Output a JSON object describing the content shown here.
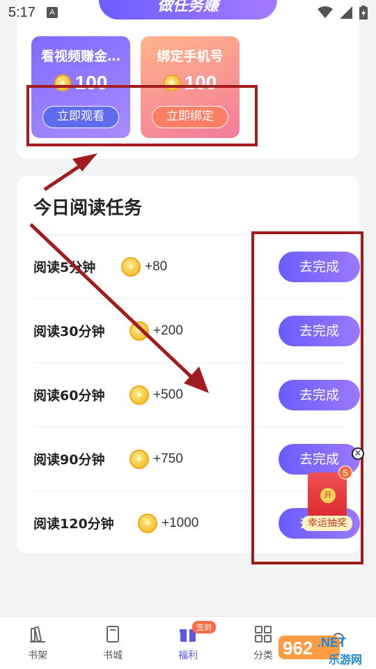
{
  "status": {
    "time": "5:17",
    "app_icon": "A"
  },
  "banner": {
    "text": "做任务赚"
  },
  "top_tasks": [
    {
      "title": "看视频赚金…",
      "reward": "100",
      "button": "立即观看"
    },
    {
      "title": "绑定手机号",
      "reward": "100",
      "button": "立即绑定"
    }
  ],
  "daily": {
    "title": "今日阅读任务",
    "rows": [
      {
        "label": "阅读5分钟",
        "reward": "+80",
        "button": "去完成"
      },
      {
        "label": "阅读30分钟",
        "reward": "+200",
        "button": "去完成"
      },
      {
        "label": "阅读60分钟",
        "reward": "+500",
        "button": "去完成"
      },
      {
        "label": "阅读90分钟",
        "reward": "+750",
        "button": "去完成"
      },
      {
        "label": "阅读120分钟",
        "reward": "+1000",
        "button": "去完成"
      }
    ]
  },
  "redpacket": {
    "count": "5",
    "seal": "开",
    "label": "幸运抽奖"
  },
  "tabs": [
    {
      "label": "书架",
      "icon": "bookshelf-icon"
    },
    {
      "label": "书城",
      "icon": "book-icon"
    },
    {
      "label": "福利",
      "icon": "gift-icon",
      "badge": "签到",
      "active": true
    },
    {
      "label": "分类",
      "icon": "grid-icon"
    },
    {
      "label": "",
      "icon": "profile-icon"
    }
  ],
  "watermark": {
    "brand": "962",
    "suffix": ".NET",
    "sub": "乐游网"
  },
  "colors": {
    "accent": "#5b59e6",
    "annotation": "#a11c1c"
  }
}
